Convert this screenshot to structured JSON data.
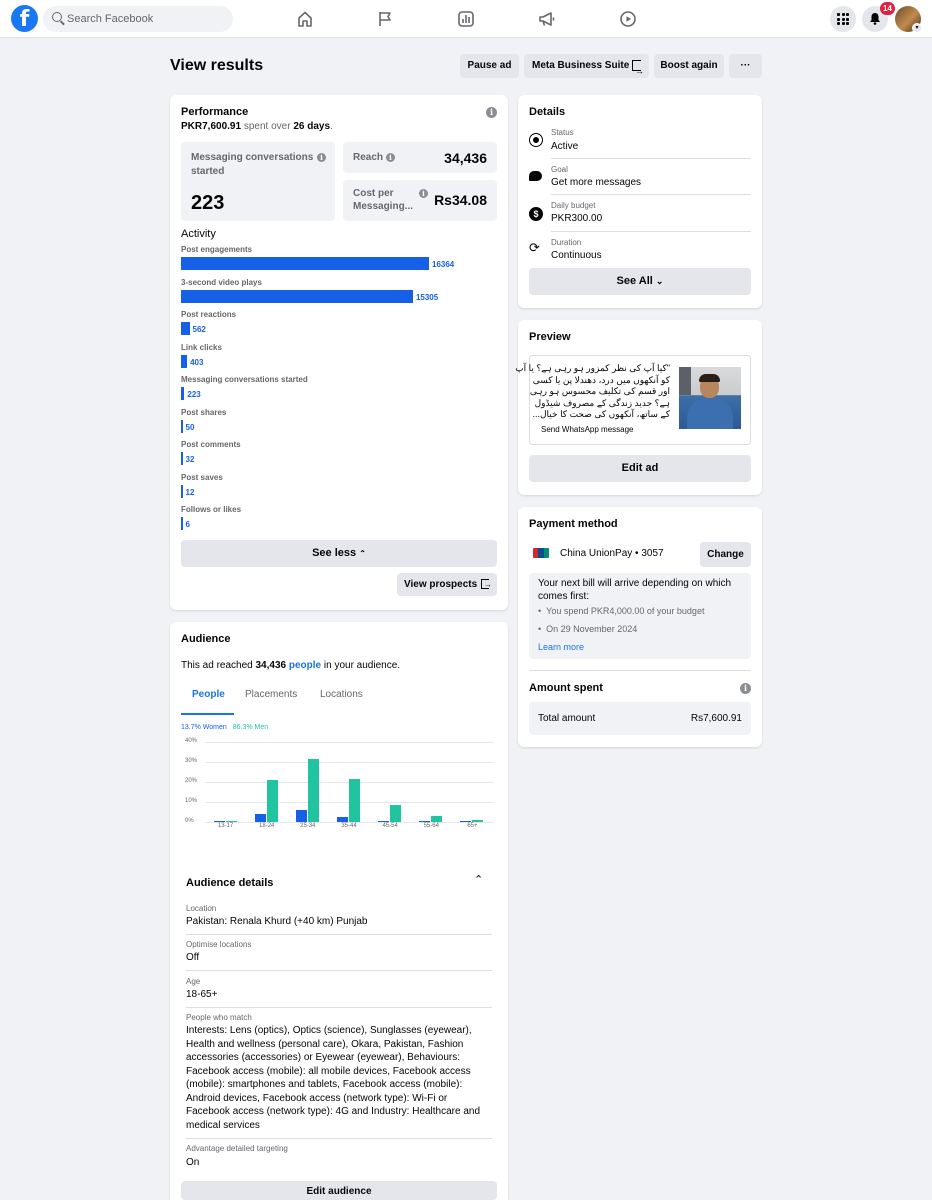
{
  "topbar": {
    "logo": "f",
    "search_placeholder": "Search Facebook",
    "notification_count": "14",
    "icons": [
      "home-icon",
      "flag-icon",
      "chart-icon",
      "megaphone-icon",
      "video-icon",
      "menu-grid-icon",
      "bell-icon"
    ]
  },
  "header": {
    "title": "View results",
    "buttons": {
      "pause": "Pause ad",
      "business_suite": "Meta Business Suite",
      "boost": "Boost again",
      "more": "···"
    }
  },
  "performance": {
    "title": "Performance",
    "spent_prefix": "PKR7,600.91",
    "spent_mid": " spent over ",
    "spent_days": "26 days",
    "spent_suffix": ".",
    "messaging_label_1": "Messaging conversations",
    "messaging_label_2": "started",
    "messaging_value": "223",
    "reach_label": "Reach",
    "reach_value": "34,436",
    "cost_label_1": "Cost per",
    "cost_label_2": "Messaging...",
    "cost_value": "Rs34.08",
    "activity_title": "Activity",
    "activity": [
      {
        "label": "Post engagements",
        "value": 16364,
        "display": "16364"
      },
      {
        "label": "3-second video plays",
        "value": 15305,
        "display": "15305"
      },
      {
        "label": "Post reactions",
        "value": 562,
        "display": "562"
      },
      {
        "label": "Link clicks",
        "value": 403,
        "display": "403"
      },
      {
        "label": "Messaging conversations started",
        "value": 223,
        "display": "223"
      },
      {
        "label": "Post shares",
        "value": 50,
        "display": "50"
      },
      {
        "label": "Post comments",
        "value": 32,
        "display": "32"
      },
      {
        "label": "Post saves",
        "value": 12,
        "display": "12"
      },
      {
        "label": "Follows or likes",
        "value": 6,
        "display": "6"
      }
    ],
    "see_less": "See less",
    "view_prospects": "View prospects"
  },
  "details": {
    "title": "Details",
    "rows": [
      {
        "label": "Status",
        "value": "Active"
      },
      {
        "label": "Goal",
        "value": "Get more messages"
      },
      {
        "label": "Daily budget",
        "value": "PKR300.00"
      },
      {
        "label": "Duration",
        "value": "Continuous"
      }
    ],
    "see_all": "See All"
  },
  "preview": {
    "title": "Preview",
    "lines": [
      "\"کیا آپ کی نظر کمزور ہو رہی ہے؟ یا آپ",
      "کو آنکھوں میں درد، دھندلا پن یا کسی",
      "اور قسم کی تکلیف محسوس ہو رہی",
      "ہے؟ جدید زندگی کے مصروف شیڈول",
      "کے ساتھ، آنکھوں کی صحت کا خیال..."
    ],
    "cta": "Send WhatsApp message",
    "edit_ad": "Edit ad"
  },
  "payment": {
    "title": "Payment method",
    "card_name": "China UnionPay • 3057",
    "change": "Change",
    "bill_intro": "Your next bill will arrive depending on which comes first:",
    "bullets": [
      "You spend PKR4,000.00 of your budget",
      "On 29 November 2024"
    ],
    "learn_more": "Learn more"
  },
  "amount": {
    "title": "Amount spent",
    "total_label": "Total amount",
    "total_value": "Rs7,600.91"
  },
  "audience": {
    "title": "Audience",
    "reached_prefix": "This ad reached ",
    "reached_count": "34,436",
    "reached_people": "people",
    "reached_suffix": " in your audience.",
    "tabs": [
      "People",
      "Placements",
      "Locations"
    ],
    "legend_women": "13.7% Women",
    "legend_men": "86.3% Men",
    "details_title": "Audience details",
    "details": [
      {
        "label": "Location",
        "value": "Pakistan: Renala Khurd (+40 km) Punjab"
      },
      {
        "label": "Optimise locations",
        "value": "Off"
      },
      {
        "label": "Age",
        "value": "18-65+"
      },
      {
        "label": "People who match",
        "value": "Interests: Lens (optics), Optics (science), Sunglasses (eyewear), Health and wellness (personal care), Okara, Pakistan, Fashion accessories (accessories) or Eyewear (eyewear), Behaviours: Facebook access (mobile): all mobile devices, Facebook access (mobile): smartphones and tablets, Facebook access (mobile): Android devices, Facebook access (network type): Wi-Fi or Facebook access (network type): 4G and Industry: Healthcare and medical services"
      },
      {
        "label": "Advantage detailed targeting",
        "value": "On"
      }
    ],
    "edit_audience": "Edit audience"
  },
  "colors": {
    "women": "#1660e8",
    "men": "#20c4a0",
    "accent": "#1b74e4"
  },
  "chart_data": {
    "type": "bar",
    "categories": [
      "13-17",
      "18-24",
      "25-34",
      "35-44",
      "45-54",
      "55-64",
      "65+"
    ],
    "series": [
      {
        "name": "Women",
        "values": [
          0.2,
          4,
          6,
          2.5,
          0.6,
          0.3,
          0.2
        ]
      },
      {
        "name": "Men",
        "values": [
          0.3,
          21,
          31.5,
          21.5,
          8.5,
          3,
          1
        ]
      }
    ],
    "ylim": [
      0,
      40
    ],
    "yticks": [
      "0%",
      "10%",
      "20%",
      "30%",
      "40%"
    ],
    "grid": true,
    "legend": "top-left"
  }
}
